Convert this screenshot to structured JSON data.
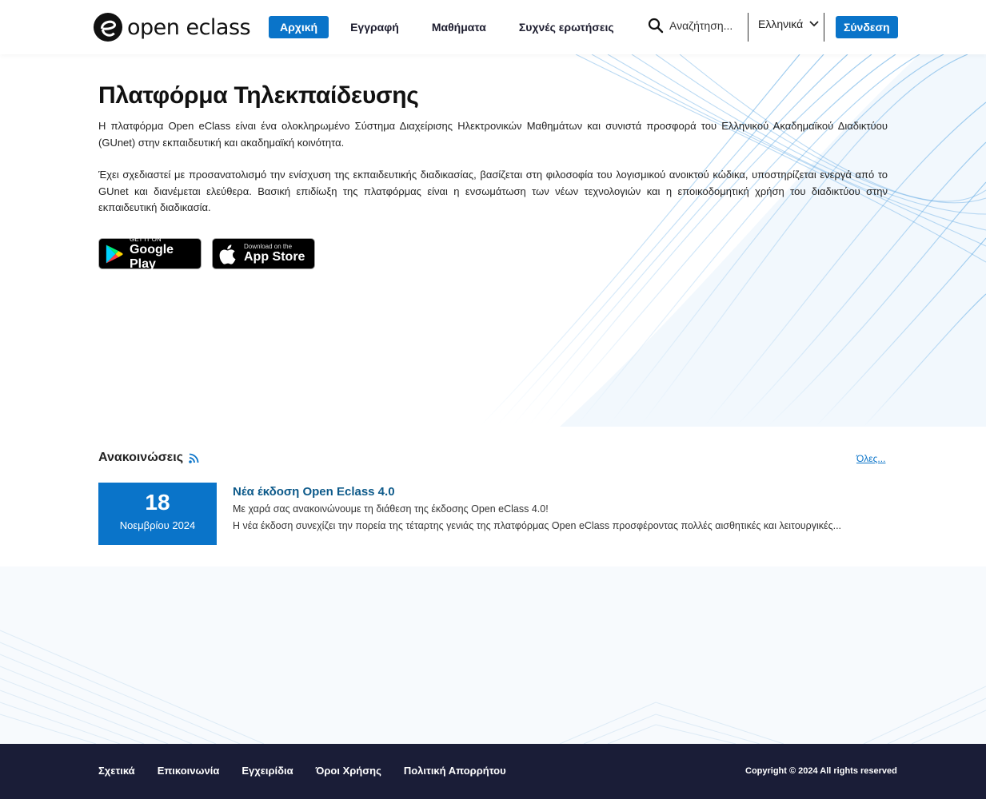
{
  "header": {
    "logo_text": "open eclass",
    "nav": [
      {
        "label": "Αρχική",
        "active": true
      },
      {
        "label": "Εγγραφή",
        "active": false
      },
      {
        "label": "Μαθήματα",
        "active": false
      },
      {
        "label": "Συχνές ερωτήσεις",
        "active": false
      }
    ],
    "search_placeholder": "Αναζήτηση...",
    "language": "Ελληνικά",
    "login_label": "Σύνδεση"
  },
  "hero": {
    "title": "Πλατφόρμα Τηλεκπαίδευσης",
    "paragraph1": "Η πλατφόρμα Open eClass είναι ένα ολοκληρωμένο Σύστημα Διαχείρισης Ηλεκτρονικών Μαθημάτων και συνιστά προσφορά του Ελληνικού Ακαδημαϊκού Διαδικτύου (GUnet) στην εκπαιδευτική και ακαδημαϊκή κοινότητα.",
    "paragraph2": "Έχει σχεδιαστεί με προσανατολισμό την ενίσχυση της εκπαιδευτικής διαδικασίας, βασίζεται στη φιλοσοφία του λογισμικού ανοικτού κώδικα, υποστηρίζεται ενεργά από το GUnet και διανέμεται ελεύθερα. Βασική επιδίωξη της πλατφόρμας είναι η ενσωμάτωση των νέων τεχνολογιών και η εποικοδομητική χρήση του διαδικτύου στην εκπαιδευτική διαδικασία.",
    "google_play": {
      "small": "GET IT ON",
      "big": "Google Play"
    },
    "app_store": {
      "small": "Download on the",
      "big": "App Store"
    }
  },
  "announcements": {
    "title": "Ανακοινώσεις",
    "all_link": "Όλες...",
    "items": [
      {
        "day": "18",
        "month_year": "Νοεμβρίου 2024",
        "headline": "Νέα έκδοση Open Eclass 4.0",
        "line1": "Με χαρά σας ανακοινώνουμε τη διάθεση της έκδοσης Open eClass 4.0!",
        "line2": "Η νέα έκδοση συνεχίζει την πορεία της τέταρτης γενιάς της πλατφόρμας Open eClass προσφέροντας πολλές αισθητικές και λειτουργικές..."
      }
    ]
  },
  "footer": {
    "links": [
      "Σχετικά",
      "Επικοινωνία",
      "Εγχειρίδια",
      "Όροι Χρήσης",
      "Πολιτική Απορρήτου"
    ],
    "copyright": "Copyright © 2024 All rights reserved"
  },
  "colors": {
    "accent": "#0a74c9",
    "footer_bg": "#1a1d37",
    "headline": "#0d5a8a"
  }
}
